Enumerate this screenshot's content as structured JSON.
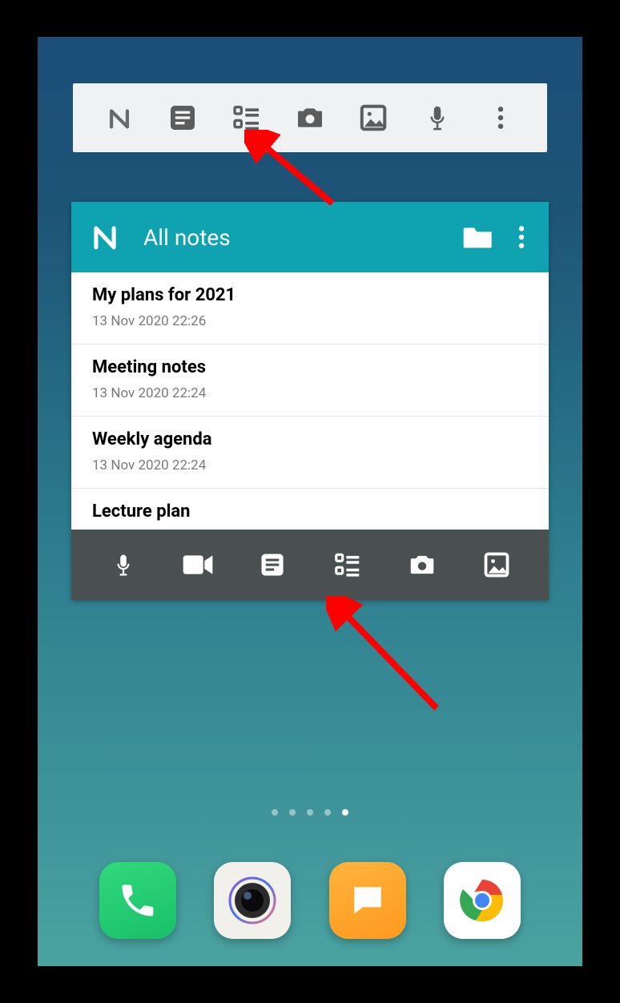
{
  "widget_bar": {
    "icons": [
      "nimbus",
      "note",
      "list",
      "camera",
      "image",
      "mic",
      "menu"
    ]
  },
  "notes_widget": {
    "header": {
      "title": "All notes"
    },
    "notes": [
      {
        "title": "My plans for 2021",
        "date": "13 Nov 2020 22:26"
      },
      {
        "title": "Meeting notes",
        "date": "13 Nov 2020 22:24"
      },
      {
        "title": "Weekly agenda",
        "date": "13 Nov 2020 22:24"
      },
      {
        "title": "Lecture plan",
        "date": ""
      }
    ],
    "toolbar_icons": [
      "mic",
      "video",
      "note",
      "list",
      "camera",
      "image"
    ]
  },
  "page_indicator": {
    "count": 5,
    "active": 4
  },
  "dock": {
    "apps": [
      "Phone",
      "Camera",
      "Messages",
      "Chrome"
    ]
  },
  "annotations": {
    "arrow_targets": [
      "widget-bar list-icon",
      "notes-toolbar list-icon"
    ]
  }
}
